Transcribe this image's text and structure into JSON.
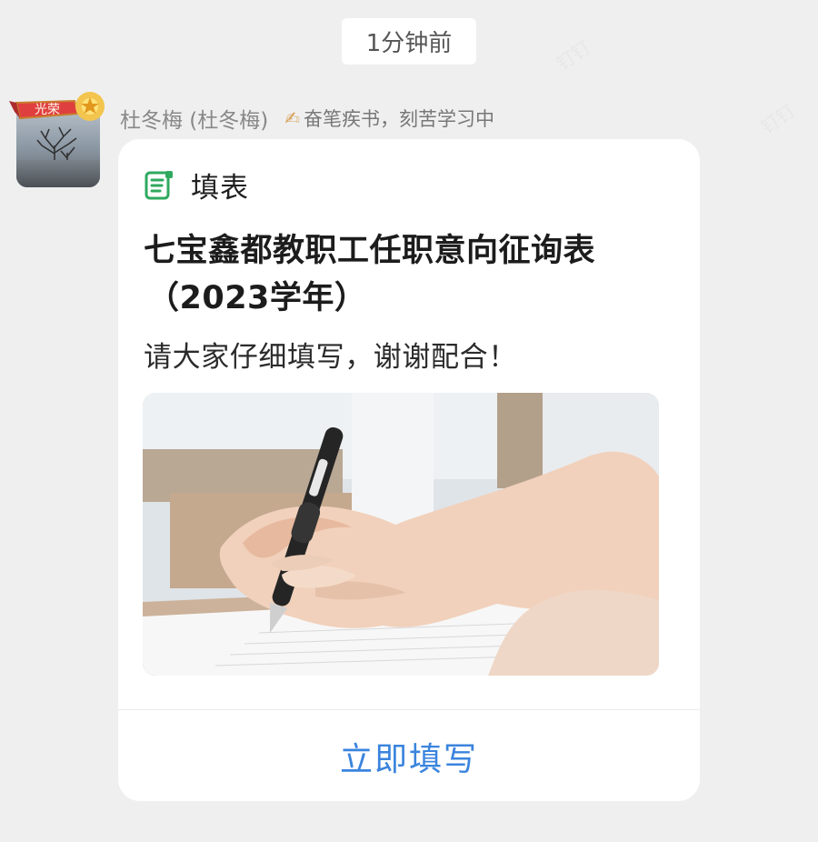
{
  "timestamp": "1分钟前",
  "sender": {
    "name": "杜冬梅 (杜冬梅)",
    "status": "奋笔疾书，刻苦学习中",
    "badge": "光荣"
  },
  "card": {
    "type": "填表",
    "title_line1": "七宝鑫都教职工任职意向征询表",
    "title_line2": "（2023学年）",
    "description": "请大家仔细填写，谢谢配合！",
    "action": "立即填写"
  },
  "watermark": "钉钉"
}
